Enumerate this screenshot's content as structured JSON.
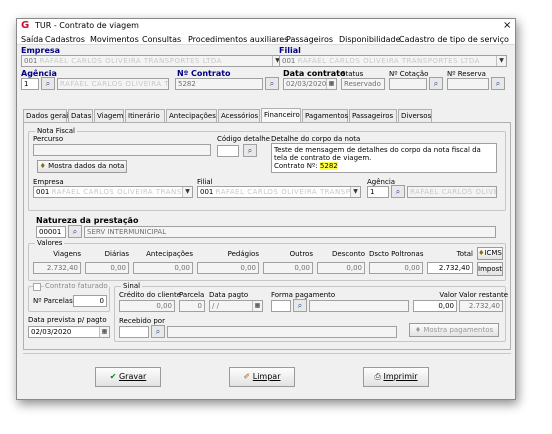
{
  "window": {
    "title": "TUR - Contrato de viagem",
    "close": "×"
  },
  "menu": [
    "Saída",
    "Cadastros",
    "Movimentos",
    "Consultas",
    "Procedimentos auxiliares",
    "Passageiros",
    "Disponibilidade",
    "Cadastro de tipo de serviço"
  ],
  "header": {
    "empresa_label": "Empresa",
    "empresa_value": "001",
    "empresa_name": "RAFAEL CARLOS OLIVEIRA TRANSPORTES LTDA",
    "filial_label": "Filial",
    "filial_value": "001",
    "filial_name": "RAFAEL CARLOS OLIVEIRA TRANSPORTES LTDA",
    "agencia_label": "Agência",
    "agencia_value": "1",
    "agencia_name": "RAFAEL CARLOS OLIVEIRA TRANSPORTES",
    "contrato_label": "Nº Contrato",
    "contrato_value": "5282",
    "data_contrato_label": "Data contrato",
    "data_contrato_value": "02/03/2020",
    "status_label": "Status",
    "status_value": "Reservado",
    "cotacao_label": "Nº Cotação",
    "reserva_label": "Nº Reserva"
  },
  "tabs": [
    "Dados gerais",
    "Datas",
    "Viagem",
    "Itinerário",
    "Antecipações",
    "Acessórios",
    "Financeiro",
    "Pagamentos",
    "Passageiros",
    "Diversos"
  ],
  "active_tab": "Financeiro",
  "nota_fiscal": {
    "title": "Nota Fiscal",
    "percurso_label": "Percurso",
    "percurso_value": "",
    "codigo_detalhe_label": "Código detalhe",
    "detalhe_label": "Detalhe do corpo da nota",
    "detalhe_text": "Teste de mensagem de detalhes do corpo da nota fiscal da tela de contrato de viagem.",
    "detalhe_contrato_prefix": "Contrato Nº:",
    "detalhe_contrato_value": "5282",
    "mostra_button": "Mostra dados da nota",
    "empresa_label": "Empresa",
    "empresa_value": "001",
    "empresa_name": "RAFAEL CARLOS OLIVEIRA TRANSPORTES LTDA",
    "filial_label": "Filial",
    "filial_value": "001",
    "filial_name": "RAFAEL CARLOS OLIVEIRA TRANSPORTES LTDA",
    "agencia_label": "Agência",
    "agencia_value": "1",
    "agencia_name": "RAFAEL CARLOS OLIVEIRA TRANSPORTES"
  },
  "natureza": {
    "label": "Natureza da prestação",
    "code": "00001",
    "desc": "SERV INTERMUNICIPAL"
  },
  "valores": {
    "title": "Valores",
    "headers": [
      "Viagens",
      "Diárias",
      "Antecipações",
      "Pedágios",
      "Outros",
      "Desconto",
      "Dscto Poltronas",
      "Total"
    ],
    "values": [
      "2.732,40",
      "0,00",
      "0,00",
      "0,00",
      "0,00",
      "0,00",
      "0,00",
      "2.732,40"
    ],
    "icms_button": "ICMS",
    "impostos_button": "Impostos"
  },
  "faturado": {
    "checkbox_label": "Contrato faturado",
    "parcelas_label": "Nº Parcelas",
    "parcelas_value": "0",
    "data_prevista_label": "Data prevista p/ pagto",
    "data_prevista_value": "02/03/2020"
  },
  "sinal": {
    "title": "Sinal",
    "credito_label": "Crédito do cliente",
    "credito_value": "0,00",
    "parcela_label": "Parcela",
    "parcela_value": "0",
    "data_pagto_label": "Data pagto",
    "data_pagto_value": "/ /",
    "forma_label": "Forma pagamento",
    "forma_value": "",
    "valor_label": "Valor",
    "valor_value": "0,00",
    "restante_label": "Valor restante",
    "restante_value": "2.732,40",
    "recebido_label": "Recebido por",
    "recebido_value": "",
    "mostra_pagamentos": "Mostra pagamentos"
  },
  "footer": {
    "gravar": "Gravar",
    "limpar": "Limpar",
    "imprimir": "Imprimir"
  },
  "colors": {
    "accent_label": "#000080",
    "highlight": "#ffff40",
    "brand": "#c8102e"
  }
}
